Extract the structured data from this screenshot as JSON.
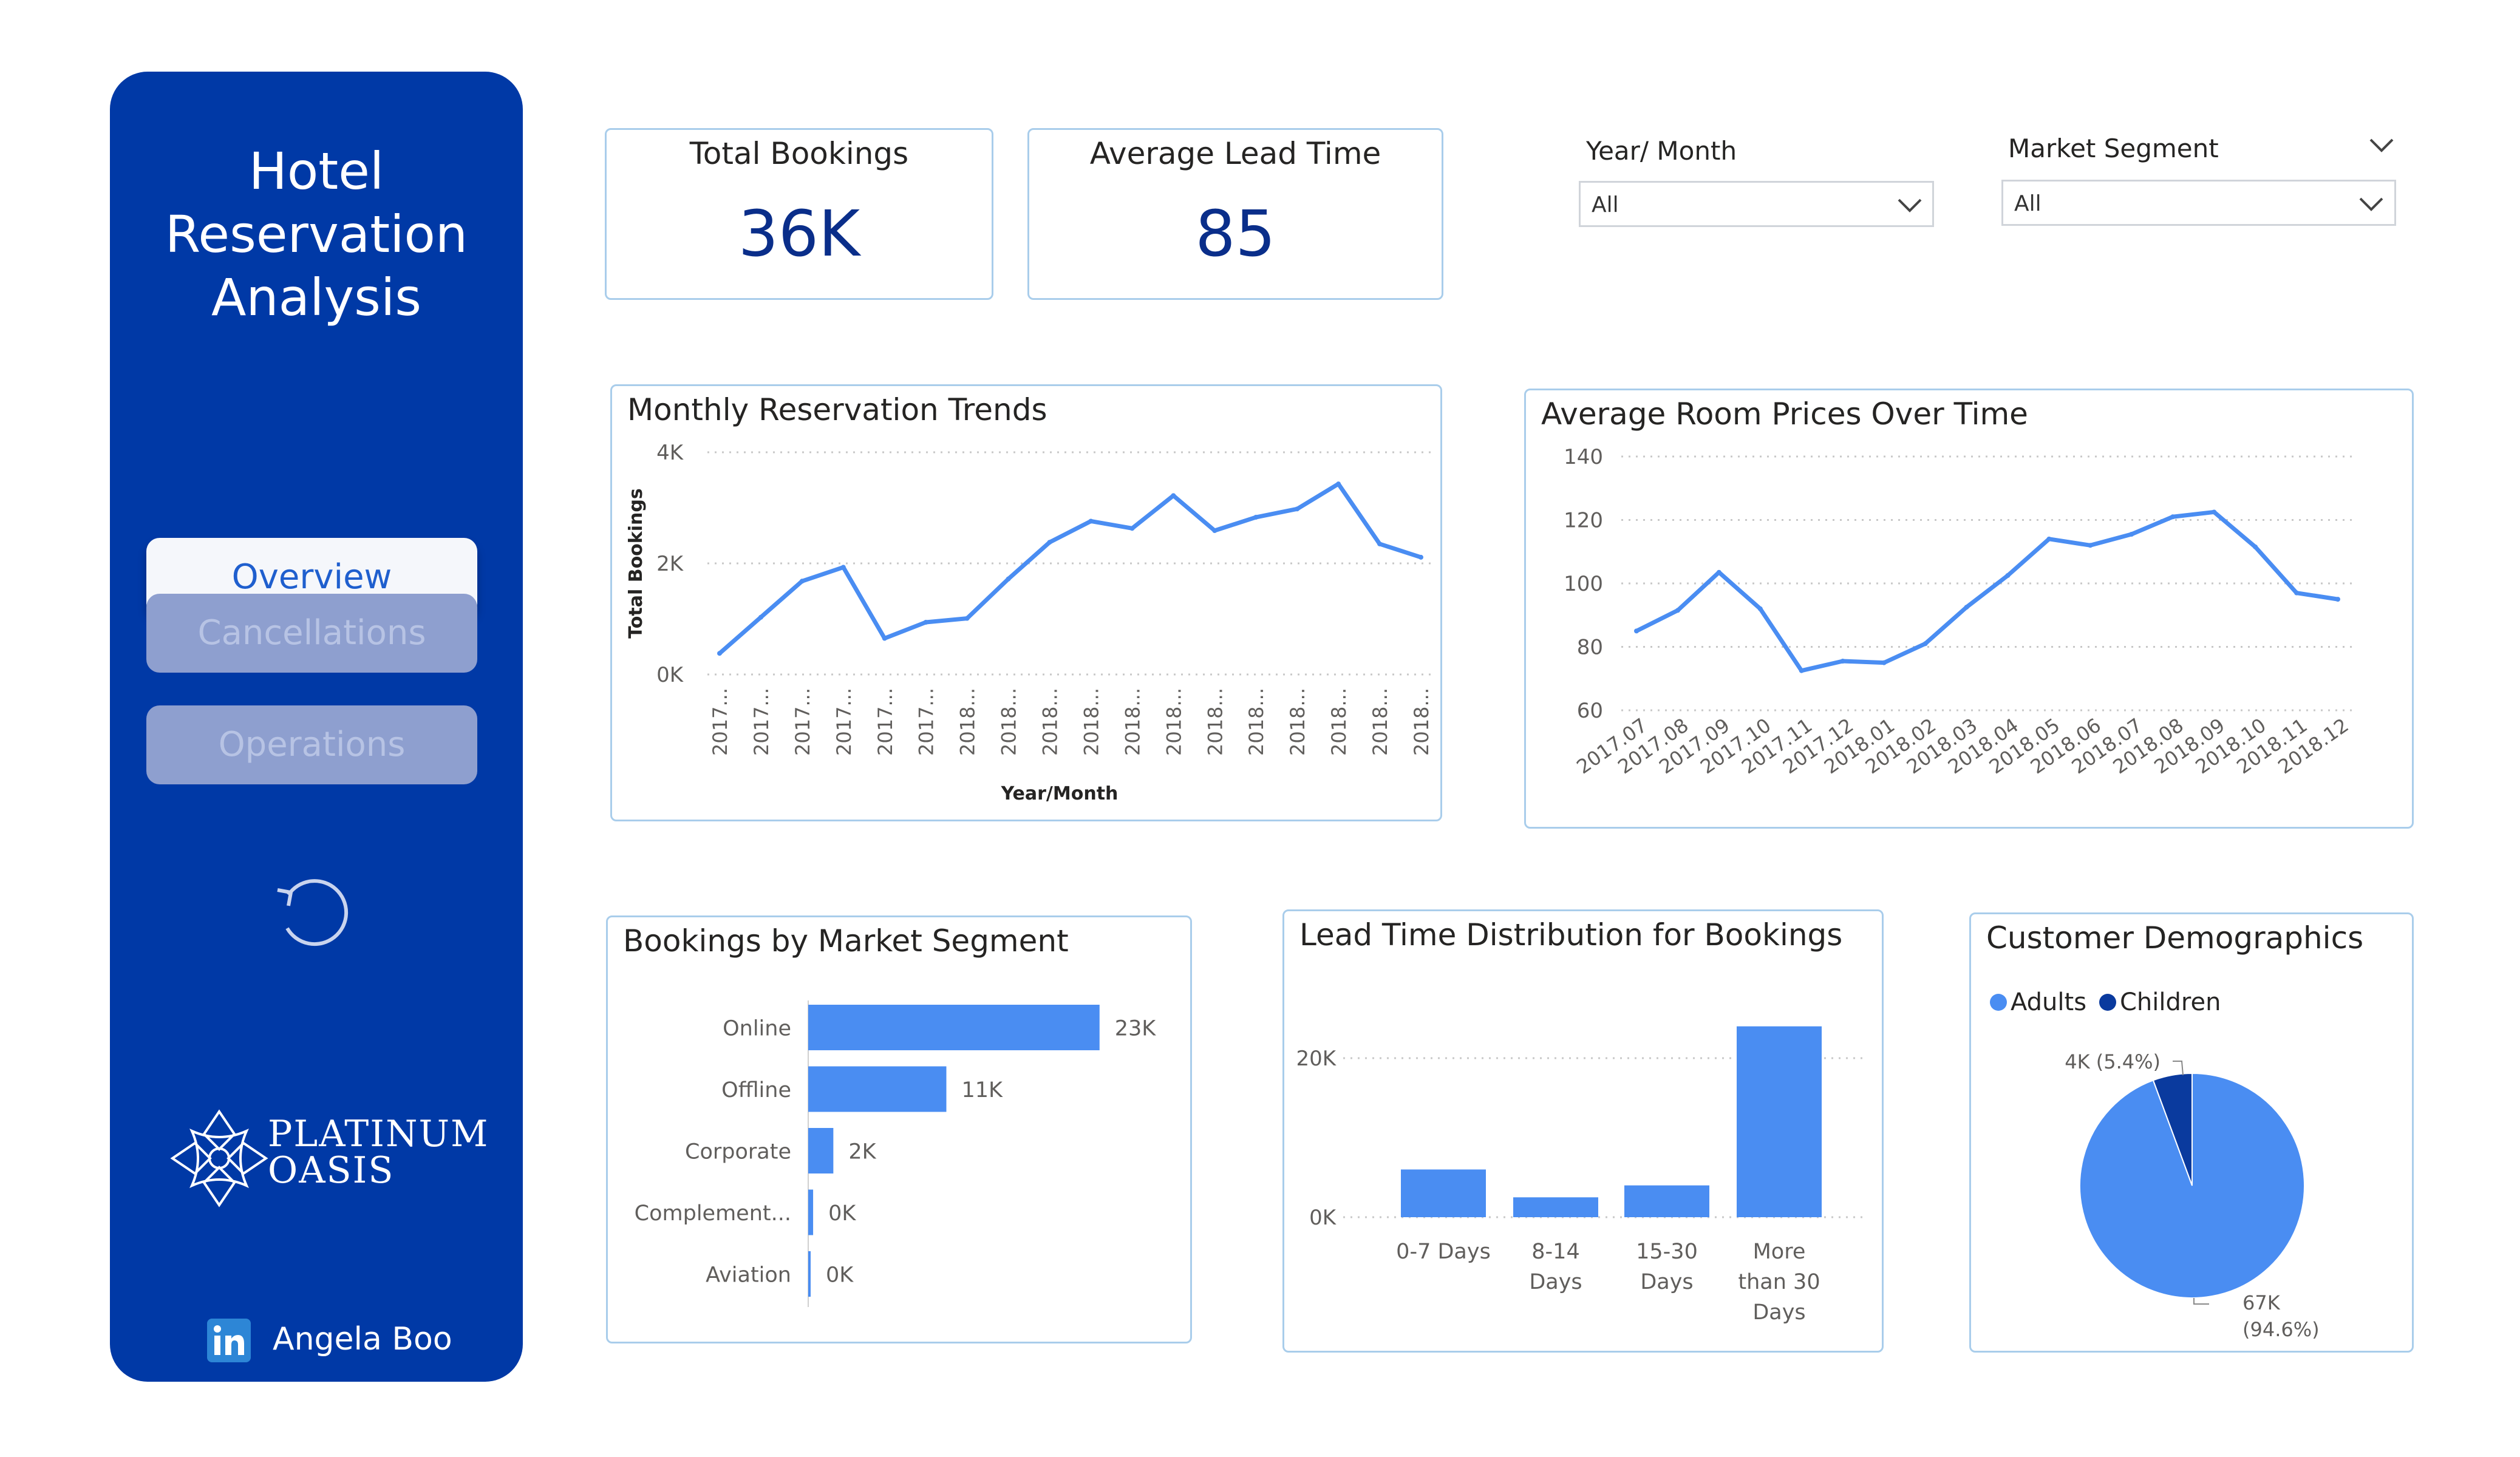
{
  "sidebar": {
    "title_lines": [
      "Hotel",
      "Reservation",
      "Analysis"
    ],
    "nav": [
      {
        "label": "Overview",
        "active": true
      },
      {
        "label": "Cancellations",
        "active": false
      },
      {
        "label": "Operations",
        "active": false
      }
    ],
    "refresh_icon": "refresh-icon",
    "logo": {
      "line1": "PLATINUM",
      "line2": "OASIS",
      "icon": "ornament-logo"
    },
    "author": {
      "icon": "linkedin-icon",
      "name": "Angela Boo"
    }
  },
  "kpis": [
    {
      "label": "Total Bookings",
      "value": "36K"
    },
    {
      "label": "Average Lead Time",
      "value": "85"
    }
  ],
  "slicers": [
    {
      "label": "Year/ Month",
      "value": "All"
    },
    {
      "label": "Market Segment",
      "value": "All"
    }
  ],
  "colors": {
    "sidebar": "#0039A6",
    "accent": "#4A8DF2",
    "dark_series": "#0A3A9E",
    "card_border": "#A9CDEB"
  },
  "chart_data": [
    {
      "id": "monthly",
      "type": "line",
      "title": "Monthly Reservation Trends",
      "xlabel": "Year/Month",
      "ylabel": "Total Bookings",
      "ylim": [
        0,
        4000
      ],
      "yticks": [
        "0K",
        "2K",
        "4K"
      ],
      "categories": [
        "2017...",
        "2017...",
        "2017...",
        "2017...",
        "2017...",
        "2017...",
        "2018...",
        "2018...",
        "2018...",
        "2018...",
        "2018...",
        "2018...",
        "2018...",
        "2018...",
        "2018...",
        "2018...",
        "2018...",
        "2018..."
      ],
      "values": [
        380,
        1030,
        1680,
        1930,
        650,
        940,
        1010,
        1720,
        2380,
        2760,
        2630,
        3220,
        2590,
        2830,
        2980,
        3430,
        2350,
        2110
      ]
    },
    {
      "id": "prices",
      "type": "line",
      "title": "Average Room Prices Over Time",
      "ylim": [
        60,
        140
      ],
      "yticks": [
        "60",
        "80",
        "100",
        "120",
        "140"
      ],
      "categories": [
        "2017.07",
        "2017.08",
        "2017.09",
        "2017.10",
        "2017.11",
        "2017.12",
        "2018.01",
        "2018.02",
        "2018.03",
        "2018.04",
        "2018.05",
        "2018.06",
        "2018.07",
        "2018.08",
        "2018.09",
        "2018.10",
        "2018.11",
        "2018.12"
      ],
      "values": [
        85,
        91.5,
        103.5,
        92,
        72.5,
        75.5,
        75,
        81,
        92.5,
        102.5,
        114,
        112,
        115.5,
        121,
        122.5,
        111.5,
        97,
        95
      ]
    },
    {
      "id": "segments",
      "type": "bar",
      "title": "Bookings by Market Segment",
      "categories": [
        "Online",
        "Offline",
        "Corporate",
        "Complement...",
        "Aviation"
      ],
      "values": [
        23200,
        11000,
        2000,
        390,
        120
      ],
      "labels": [
        "23K",
        "11K",
        "2K",
        "0K",
        "0K"
      ]
    },
    {
      "id": "leadtime",
      "type": "bar",
      "title": "Lead Time Distribution for Bookings",
      "categories": [
        [
          "0-7 Days"
        ],
        [
          "8-14",
          "Days"
        ],
        [
          "15-30",
          "Days"
        ],
        [
          "More",
          "than 30",
          "Days"
        ]
      ],
      "values": [
        6000,
        2500,
        4000,
        24000
      ],
      "ylim": [
        0,
        27000
      ],
      "yticks": [
        "0K",
        "20K"
      ]
    },
    {
      "id": "demographics",
      "type": "pie",
      "title": "Customer Demographics",
      "series": [
        {
          "name": "Adults",
          "value": 67000,
          "label_line1": "67K",
          "label_line2": "(94.6%)",
          "color": "#4A8DF2"
        },
        {
          "name": "Children",
          "value": 4000,
          "label_line1": "4K (5.4%)",
          "label_line2": "",
          "color": "#0A3A9E"
        }
      ],
      "legend_position": "top-left"
    }
  ]
}
